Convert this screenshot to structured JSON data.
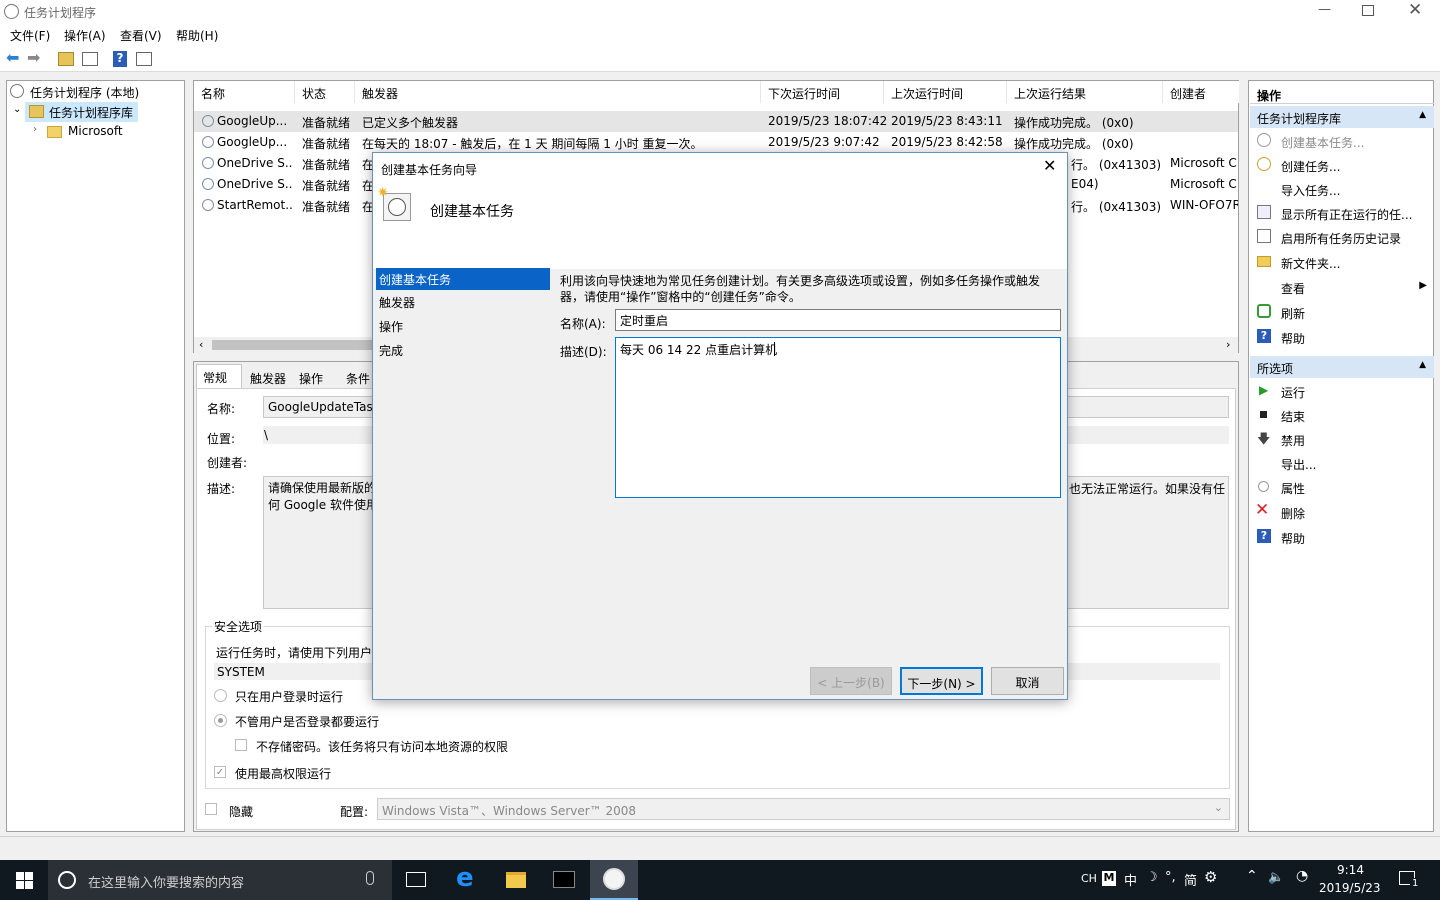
{
  "window": {
    "title": "任务计划程序"
  },
  "menu": [
    "文件(F)",
    "操作(A)",
    "查看(V)",
    "帮助(H)"
  ],
  "tree": {
    "root": "任务计划程序 (本地)",
    "library": "任务计划程序库",
    "child": "Microsoft"
  },
  "list": {
    "headers": [
      "名称",
      "状态",
      "触发器",
      "下次运行时间",
      "上次运行时间",
      "上次运行结果",
      "创建者"
    ],
    "rows": [
      [
        "GoogleUp...",
        "准备就绪",
        "已定义多个触发器",
        "2019/5/23 18:07:42",
        "2019/5/23 8:43:11",
        "操作成功完成。 (0x0)",
        ""
      ],
      [
        "GoogleUp...",
        "准备就绪",
        "在每天的 18:07 - 触发后，在 1 天 期间每隔 1 小时 重复一次。",
        "2019/5/23 9:07:42",
        "2019/5/23 8:42:58",
        "操作成功完成。 (0x0)",
        ""
      ],
      [
        "OneDrive S...",
        "准备就绪",
        "在",
        "",
        "",
        "行。 (0x41303)",
        "Microsoft C"
      ],
      [
        "OneDrive S...",
        "准备就绪",
        "在",
        "",
        "",
        "E04)",
        "Microsoft C"
      ],
      [
        "StartRemot...",
        "准备就绪",
        "在",
        "",
        "",
        "行。 (0x41303)",
        "WIN-OFO7R"
      ]
    ]
  },
  "details": {
    "tabs": [
      "常规",
      "触发器",
      "操作",
      "条件"
    ],
    "name_label": "名称:",
    "name_value": "GoogleUpdateTas",
    "location_label": "位置:",
    "location_value": "\\",
    "author_label": "创建者:",
    "desc_label": "描述:",
    "desc_value_left": "请确保使用最新版的\n何 Google 软件使用",
    "desc_value_right": "也无法正常运行。如果没有任",
    "security_title": "安全选项",
    "security_runas": "运行任务时，请使用下列用户",
    "security_user": "SYSTEM",
    "opt_logged_on": "只在用户登录时运行",
    "opt_whether": "不管用户是否登录都要运行",
    "opt_no_password": "不存储密码。该任务将只有访问本地资源的权限",
    "opt_highest": "使用最高权限运行",
    "hidden_label": "隐藏",
    "config_label": "配置:",
    "config_value": "Windows Vista™、Windows Server™ 2008"
  },
  "actions": {
    "title": "操作",
    "section1": "任务计划程序库",
    "items1": [
      "创建基本任务...",
      "创建任务...",
      "导入任务...",
      "显示所有正在运行的任...",
      "启用所有任务历史记录",
      "新文件夹...",
      "查看",
      "刷新",
      "帮助"
    ],
    "section2": "所选项",
    "items2": [
      "运行",
      "结束",
      "禁用",
      "导出...",
      "属性",
      "删除",
      "帮助"
    ]
  },
  "dialog": {
    "title": "创建基本任务向导",
    "heading": "创建基本任务",
    "steps": [
      "创建基本任务",
      "触发器",
      "操作",
      "完成"
    ],
    "intro": "利用该向导快速地为常见任务创建计划。有关更多高级选项或设置，例如多任务操作或触发器，请使用“操作”窗格中的“创建任务”命令。",
    "name_label": "名称(A):",
    "name_value": "定时重启",
    "desc_label": "描述(D):",
    "desc_value": "每天 06 14 22 点重启计算机",
    "back": "< 上一步(B)",
    "next": "下一步(N) >",
    "cancel": "取消"
  },
  "taskbar": {
    "search_placeholder": "在这里输入你要搜索的内容",
    "time": "9:14",
    "date": "2019/5/23",
    "ime": [
      "CH",
      "中",
      "简"
    ],
    "notif_count": "1"
  }
}
